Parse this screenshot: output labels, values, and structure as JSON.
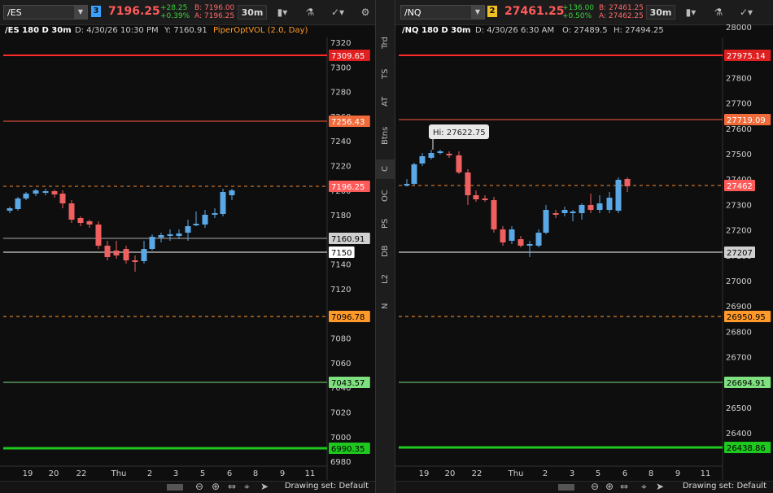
{
  "left": {
    "symbol": "/ES",
    "link": "3",
    "link_color": "#3aa0ff",
    "last": "7196.25",
    "change_abs": "+28.25",
    "change_pct": "+0.39%",
    "bid": "B: 7196.00",
    "ask": "A: 7196.25",
    "aggregation": "30m",
    "info_symbol": "/ES 180 D 30m",
    "info_date": "D: 4/30/26 10:30 PM",
    "info_y": "Y: 7160.91",
    "study": "PiperOptVOL (2.0, Day)",
    "yaxis_ticks": [
      "7320",
      "7300",
      "7280",
      "7260",
      "7240",
      "7220",
      "7200",
      "7180",
      "7160",
      "7140",
      "7120",
      "7100",
      "7080",
      "7060",
      "7040",
      "7020",
      "7000",
      "6980"
    ],
    "xaxis_ticks": [
      "19",
      "20",
      "22",
      "Thu",
      "2",
      "3",
      "5",
      "6",
      "8",
      "9",
      "11"
    ],
    "levels": [
      {
        "label": "7309.65",
        "color": "#ff2a2a",
        "box": "#e02020",
        "text": "#fff",
        "style": "solid"
      },
      {
        "label": "7256.43",
        "color": "#ff5a3a",
        "box": "#f06a3a",
        "text": "#fff",
        "style": "solid"
      },
      {
        "label": "7196.25",
        "color": "#ff8a2a",
        "box": "#ff5a5a",
        "text": "#fff",
        "style": "dash"
      },
      {
        "label": "7160.91",
        "color": "#aaaaaa",
        "box": "#d0d0d0",
        "text": "#000",
        "style": "solid"
      },
      {
        "label": "7150",
        "color": "#ffffff",
        "box": "#ffffff",
        "text": "#000",
        "style": "solid"
      },
      {
        "label": "7096.78",
        "color": "#ff9a2a",
        "box": "#ff9a2a",
        "text": "#000",
        "style": "dash"
      },
      {
        "label": "7043.57",
        "color": "#7ee07e",
        "box": "#7ee07e",
        "text": "#000",
        "style": "solid"
      },
      {
        "label": "6990.35",
        "color": "#1ec81e",
        "box": "#1ec81e",
        "text": "#000",
        "style": "solid"
      }
    ],
    "drawing_set": "Drawing set: Default"
  },
  "right": {
    "symbol": "/NQ",
    "link": "2",
    "link_color": "#f0c020",
    "last": "27461.25",
    "change_abs": "+136.00",
    "change_pct": "+0.50%",
    "bid": "B: 27461.25",
    "ask": "A: 27462.25",
    "aggregation": "30m",
    "info_symbol": "/NQ 180 D 30m",
    "info_date": "D: 4/30/26 6:30 AM",
    "info_o": "O: 27489.5",
    "info_h": "H: 27494.25",
    "yaxis_ticks": [
      "28000",
      "27900",
      "27800",
      "27700",
      "27600",
      "27500",
      "27400",
      "27300",
      "27200",
      "27100",
      "27000",
      "26900",
      "26800",
      "26700",
      "26600",
      "26500",
      "26400"
    ],
    "xaxis_ticks": [
      "19",
      "20",
      "22",
      "Thu",
      "2",
      "3",
      "5",
      "6",
      "8",
      "9",
      "11"
    ],
    "hi_label": "Hi: 27622.75",
    "levels": [
      {
        "label": "27975.14",
        "color": "#ff2a2a",
        "box": "#e02020",
        "text": "#fff",
        "style": "solid"
      },
      {
        "label": "27719.09",
        "color": "#ff5a3a",
        "box": "#f06a3a",
        "text": "#fff",
        "style": "solid"
      },
      {
        "label": "27462",
        "color": "#ff8a2a",
        "box": "#ff5a5a",
        "text": "#fff",
        "style": "dash"
      },
      {
        "label": "27207",
        "color": "#ffffff",
        "box": "#d0d0d0",
        "text": "#000",
        "style": "solid"
      },
      {
        "label": "26950.95",
        "color": "#ff9a2a",
        "box": "#ff9a2a",
        "text": "#000",
        "style": "dash"
      },
      {
        "label": "26694.91",
        "color": "#7ee07e",
        "box": "#7ee07e",
        "text": "#000",
        "style": "solid"
      },
      {
        "label": "26438.86",
        "color": "#1ec81e",
        "box": "#1ec81e",
        "text": "#000",
        "style": "solid"
      }
    ],
    "drawing_set": "Drawing set: Default"
  },
  "sidebar": [
    "Trd",
    "TS",
    "AT",
    "Btns",
    "C",
    "OC",
    "PS",
    "DB",
    "L2",
    "N"
  ],
  "sidebar_active": "C",
  "colors": {
    "up": "#5aa8e6",
    "down": "#f06060"
  }
}
